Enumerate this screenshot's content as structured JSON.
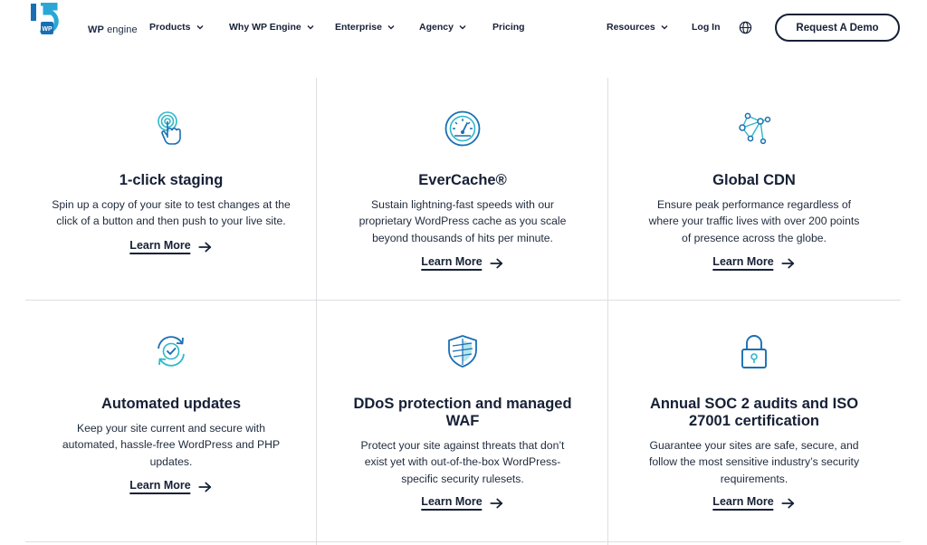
{
  "logo": {
    "number": "15",
    "badge": "WP",
    "brand_bold": "WP",
    "brand_light": " engine"
  },
  "nav": {
    "products": "Products",
    "why": "Why WP Engine",
    "enterprise": "Enterprise",
    "agency": "Agency",
    "pricing": "Pricing",
    "resources": "Resources",
    "login": "Log In",
    "demo": "Request A Demo"
  },
  "colors": {
    "navy": "#162036",
    "accent_teal": "#2fb8c8",
    "accent_blue": "#1a6fb3",
    "divider": "#dcdee2"
  },
  "features": [
    {
      "icon": "tap-finger-icon",
      "title": "1-click staging",
      "lines": [
        "Spin up a copy of your site to test changes at the",
        "click of a button and then push to your live site."
      ],
      "link": "Learn More"
    },
    {
      "icon": "speedometer-icon",
      "title": "EverCache®",
      "lines": [
        "Sustain lightning-fast speeds with our",
        "proprietary WordPress cache as you scale",
        "beyond thousands of hits per minute."
      ],
      "link": "Learn More"
    },
    {
      "icon": "network-nodes-icon",
      "title": "Global CDN",
      "lines": [
        "Ensure peak performance regardless of",
        "where your traffic lives with over 200 points",
        "of presence across the globe."
      ],
      "link": "Learn More"
    },
    {
      "icon": "refresh-check-icon",
      "title": "Automated updates",
      "lines": [
        "Keep your site current and secure with",
        "automated, hassle-free WordPress and PHP",
        "updates."
      ],
      "link": "Learn More"
    },
    {
      "icon": "shield-icon",
      "title_lines": [
        "DDoS protection and managed",
        "WAF"
      ],
      "lines": [
        "Protect your site against threats that don’t",
        "exist yet with out-of-the-box WordPress-",
        "specific security rulesets."
      ],
      "link": "Learn More"
    },
    {
      "icon": "padlock-icon",
      "title_lines": [
        "Annual SOC 2 audits and ISO",
        "27001 certification"
      ],
      "lines": [
        "Guarantee your sites are safe, secure, and",
        "follow the most sensitive industry’s security",
        "requirements."
      ],
      "link": "Learn More"
    }
  ]
}
